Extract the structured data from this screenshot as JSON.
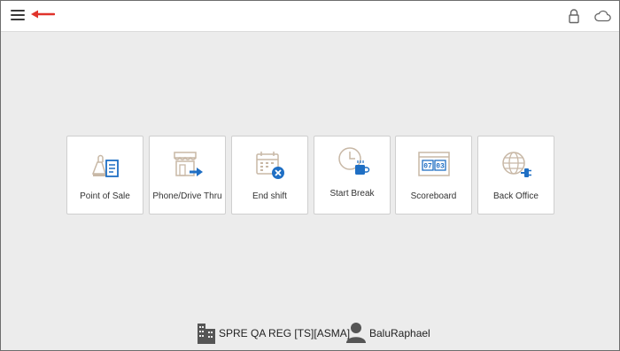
{
  "colors": {
    "accent": "#1f6fc4",
    "arrow": "#e0332b",
    "icon_beige": "#c8b8a6"
  },
  "tiles": [
    {
      "label": "Point of Sale",
      "icon": "pos-icon"
    },
    {
      "label": "Phone/Drive Thru",
      "icon": "storefront-icon"
    },
    {
      "label": "End shift",
      "icon": "calendar-cancel-icon"
    },
    {
      "label": "Start Break",
      "icon": "clock-coffee-icon"
    },
    {
      "label": "Scoreboard",
      "icon": "scoreboard-icon"
    },
    {
      "label": "Back Office",
      "icon": "globe-plug-icon"
    }
  ],
  "scoreboard_digits": [
    "07",
    "03"
  ],
  "footer": {
    "store": "SPRE QA REG [TS][ASMA]",
    "user": "BaluRaphael"
  }
}
